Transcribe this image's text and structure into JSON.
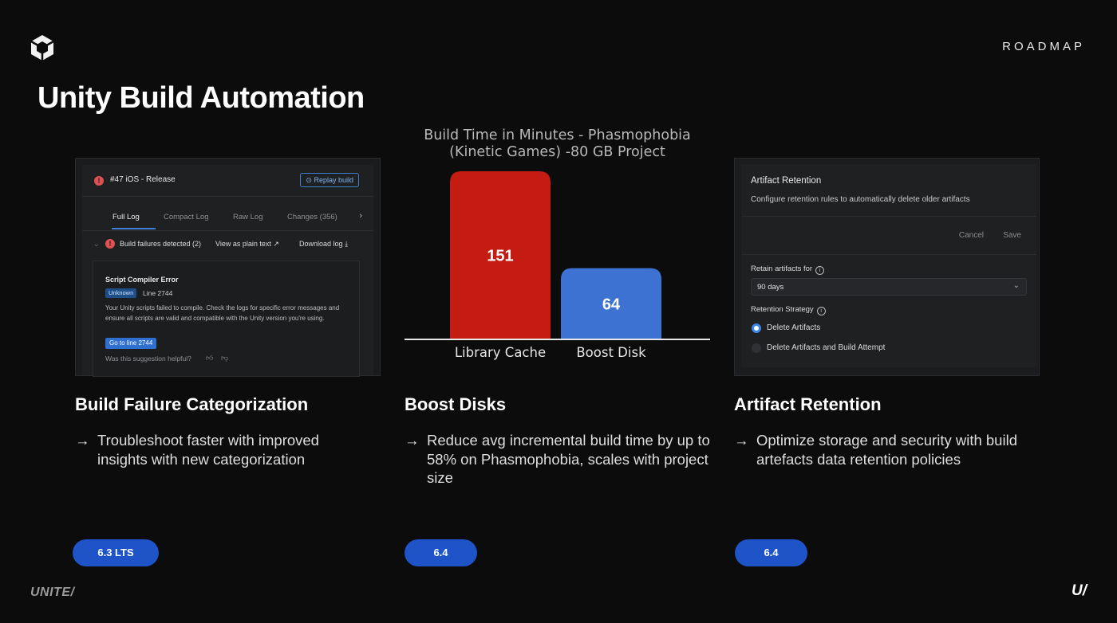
{
  "header": {
    "section_label": "ROADMAP",
    "title": "Unity Build Automation",
    "logo_icon": "unity-cube-icon"
  },
  "build_log": {
    "build_title": "#47 iOS - Release",
    "replay_label": "Replay build",
    "tabs": [
      {
        "label": "Full Log"
      },
      {
        "label": "Compact Log"
      },
      {
        "label": "Raw Log"
      },
      {
        "label": "Changes (356)"
      }
    ],
    "failures_label": "Build failures detected (2)",
    "view_plain_label": "View as plain text",
    "download_label": "Download log",
    "error": {
      "title": "Script Compiler Error",
      "badge": "Unknown",
      "line": "Line 2744",
      "description": "Your Unity scripts failed to compile. Check the logs for specific error messages and ensure all scripts are valid and compatible with the Unity version you're using.",
      "goto_label": "Go to line 2744",
      "helpful_label": "Was this suggestion helpful?"
    }
  },
  "chart_data": {
    "type": "bar",
    "title": "Build Time in Minutes - Phasmophobia (Kinetic Games) -80 GB Project",
    "categories": [
      "Library Cache",
      "Boost Disk"
    ],
    "values": [
      151,
      64
    ],
    "colors": [
      "#c41c12",
      "#3d72d2"
    ],
    "ylim": [
      0,
      151
    ],
    "xlabel": "",
    "ylabel": "",
    "grid": false
  },
  "artifact_retention": {
    "title": "Artifact Retention",
    "subtitle": "Configure retention rules to automatically delete older artifacts",
    "cancel_label": "Cancel",
    "save_label": "Save",
    "retain_label": "Retain artifacts for",
    "retain_value": "90 days",
    "strategy_label": "Retention Strategy",
    "options": [
      {
        "label": "Delete Artifacts",
        "selected": true
      },
      {
        "label": "Delete Artifacts and Build Attempt",
        "selected": false
      }
    ]
  },
  "features": [
    {
      "title": "Build Failure Categorization",
      "description": "Troubleshoot faster with improved insights with new categorization",
      "version": "6.3 LTS"
    },
    {
      "title": "Boost Disks",
      "description": "Reduce avg incremental build time by up to 58% on Phasmophobia, scales with project size",
      "version": "6.4"
    },
    {
      "title": "Artifact Retention",
      "description": "Optimize storage and security with build artefacts data retention policies",
      "version": "6.4"
    }
  ],
  "footer": {
    "event_label": "UNITE/",
    "brand_label": "U/"
  }
}
